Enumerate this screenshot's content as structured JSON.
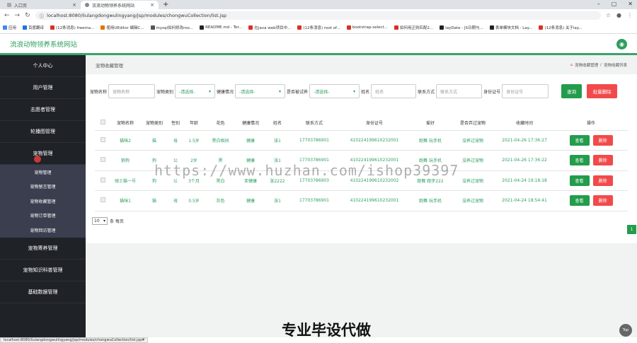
{
  "browser": {
    "tabs": [
      {
        "title": "入口页"
      },
      {
        "title": "流浪动物领养系统网站"
      }
    ],
    "url": "localhost:8080/liulangdongwulingyang/jsp/modules/chongwuCollection/list.jsp",
    "bookmarks": [
      "应用",
      "百度翻译",
      "(12条消息) freema...",
      "使用UEditor 编辑C...",
      "mysql如何修改roo...",
      "README.md - Ter...",
      "在java web项目中...",
      "(12条消息) root of...",
      "bootstrap-select...",
      "如何用正则匹配2...",
      "layDate - JS日期与...",
      "表单模块文档 - Lay...",
      "(12条消息) 关于lay..."
    ]
  },
  "app": {
    "title": "流浪动物领养系统网站",
    "avatar_icon": "user-icon"
  },
  "sidebar": {
    "items": [
      {
        "label": "个人中心"
      },
      {
        "label": "用户管理"
      },
      {
        "label": "志愿者管理"
      },
      {
        "label": "轮播图管理"
      },
      {
        "label": "宠物管理"
      }
    ],
    "submenu": [
      {
        "label": "宠物管理"
      },
      {
        "label": "宠物留言管理"
      },
      {
        "label": "宠物收藏管理"
      },
      {
        "label": "宠物订单管理"
      },
      {
        "label": "宠物回访管理"
      }
    ],
    "items_after": [
      {
        "label": "宠物寄养管理"
      },
      {
        "label": "宠物知识科普管理"
      },
      {
        "label": "基础数据管理"
      }
    ]
  },
  "page": {
    "title": "宠物收藏管理",
    "crumbs": [
      "宠物收藏管理",
      "宠物收藏列表"
    ]
  },
  "search": {
    "name_label": "宠物名称",
    "name_placeholder": "宠物名称",
    "type_label": "宠物类别",
    "type_value": "-请选择-",
    "health_label": "健康情况",
    "health_value": "-请选择-",
    "adopted_label": "是否被试养",
    "adopted_value": "-请选择-",
    "person_label": "姓名",
    "person_placeholder": "姓名",
    "phone_label": "联系方式",
    "phone_placeholder": "联系方式",
    "id_label": "身份证号",
    "id_placeholder": "身份证号",
    "query_button": "查询",
    "batch_delete_button": "批量删除"
  },
  "table": {
    "headers": [
      "宠物名称",
      "宠物类别",
      "性别",
      "年龄",
      "花色",
      "健康情况",
      "姓名",
      "联系方式",
      "身份证号",
      "爱好",
      "是否弃过宠物",
      "收藏时间",
      "操作"
    ],
    "rows": [
      {
        "cells": [
          "猫咪2",
          "猫",
          "母",
          "1.5岁",
          "黑白相间",
          "健康",
          "张1",
          "17703786901",
          "410224199610232001",
          "跑舞 玩手机",
          "没养过宠物",
          "2021-04-26 17:36:27"
        ]
      },
      {
        "cells": [
          "狼狗",
          "狗",
          "公",
          "2岁",
          "黑",
          "健康",
          "张1",
          "17703786901",
          "410224199610232001",
          "跑舞 玩手机",
          "没养过宠物",
          "2021-04-26 17:36:22"
        ]
      },
      {
        "cells": [
          "骑士猫一号",
          "狗",
          "公",
          "3个月",
          "黑白",
          "亚健康",
          "张2222",
          "17703786903",
          "410224199610232002",
          "跑舞 跑步222",
          "没养过宠物",
          "2021-04-24 19:18:18"
        ]
      },
      {
        "cells": [
          "猫咪1",
          "猫",
          "母",
          "0.5岁",
          "灰色",
          "健康",
          "张1",
          "17703786901",
          "410224199610232001",
          "跑舞 玩手机",
          "没养过宠物",
          "2021-04-24 18:54:41"
        ]
      }
    ],
    "view_label": "查看",
    "delete_label": "删除"
  },
  "pager": {
    "page_size": "10",
    "suffix": "条 每页",
    "current_page": "1"
  },
  "watermark": "https://www.huzhan.com/ishop39397",
  "banner_text": "专业毕设代做",
  "top_button": "Top",
  "status_url": "localhost:8080/liulangdongwulingyang/jsp/modules/chongwuCollection/list.jsp#",
  "colors": {
    "primary": "#239c4c",
    "danger": "#f24a4a",
    "sidebar": "#1f2227",
    "submenu": "#3a3e4f"
  }
}
